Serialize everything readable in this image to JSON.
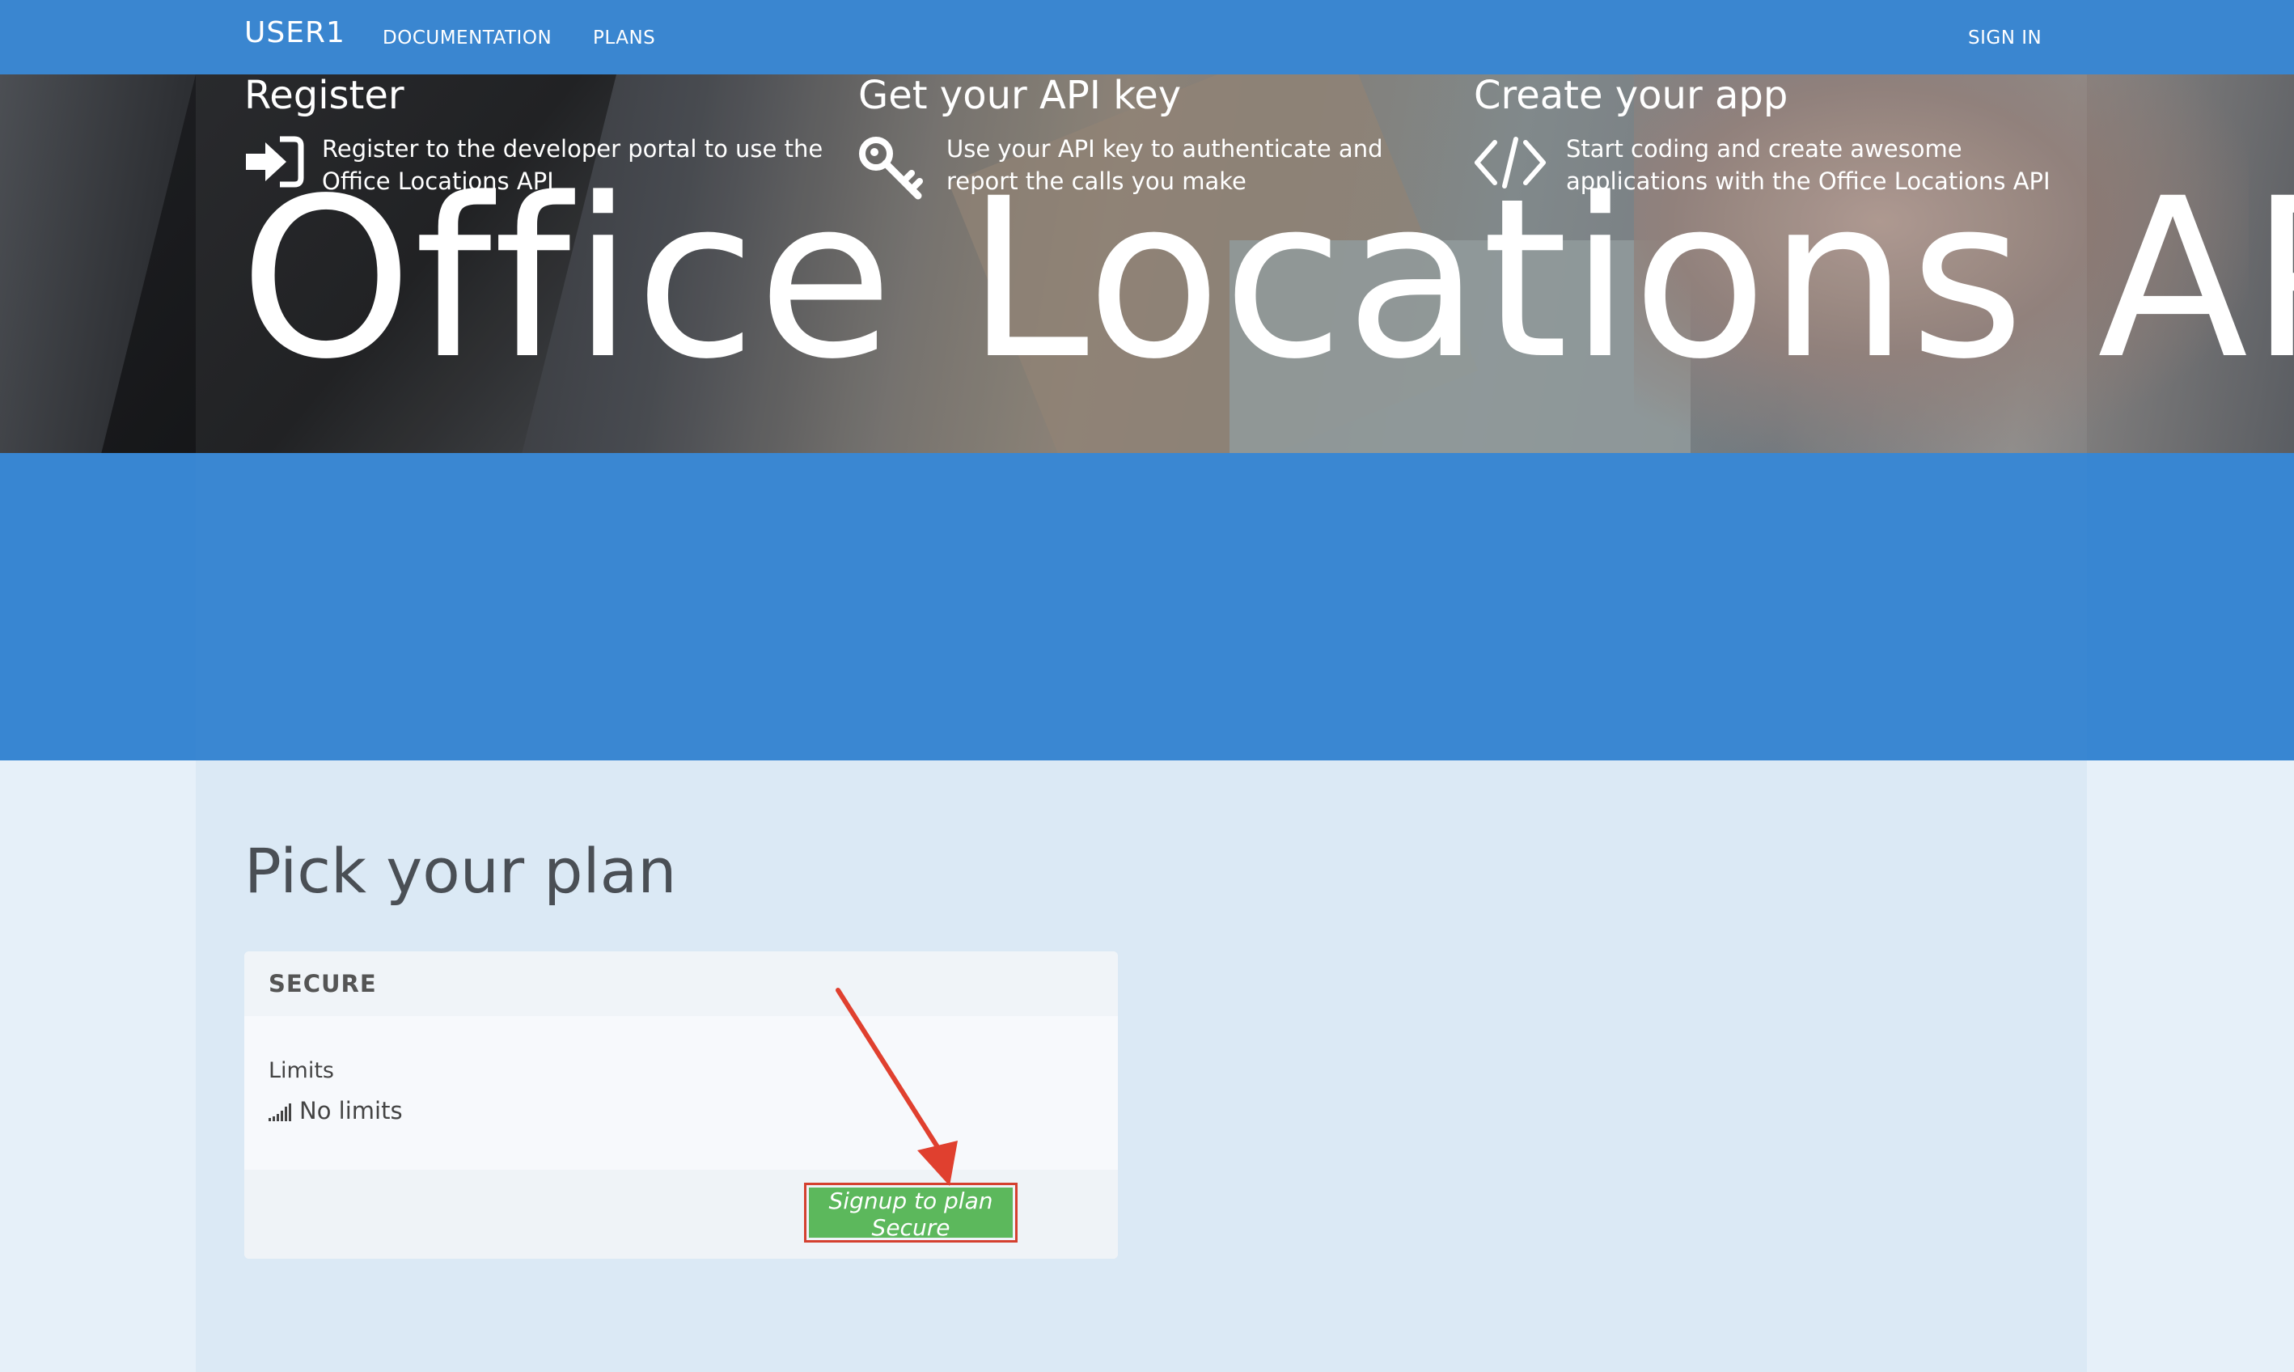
{
  "nav": {
    "brand": "USER1",
    "documentation": "DOCUMENTATION",
    "plans": "PLANS",
    "sign_in": "SIGN IN"
  },
  "hero": {
    "title": "Office Locations API"
  },
  "steps": [
    {
      "title": "Register",
      "line1": "Register to the developer portal to use the",
      "line2": "Office Locations API",
      "icon": "sign-in-icon"
    },
    {
      "title": "Get your API key",
      "line1": "Use your API key to authenticate and",
      "line2": "report the calls you make",
      "icon": "key-icon"
    },
    {
      "title": "Create your app",
      "line1": "Start coding and create awesome",
      "line2": "applications with the Office Locations API",
      "icon": "code-icon"
    }
  ],
  "plans_section": {
    "title": "Pick your plan",
    "plans": [
      {
        "name": "SECURE",
        "limits_label": "Limits",
        "limits_value": "No limits",
        "signup_label": "Signup to plan Secure"
      }
    ]
  },
  "colors": {
    "navbar": "#3a86d0",
    "steps_band": "#3a87d2",
    "signup_button": "#5cb85c",
    "annotation_arrow": "#e0402f"
  }
}
